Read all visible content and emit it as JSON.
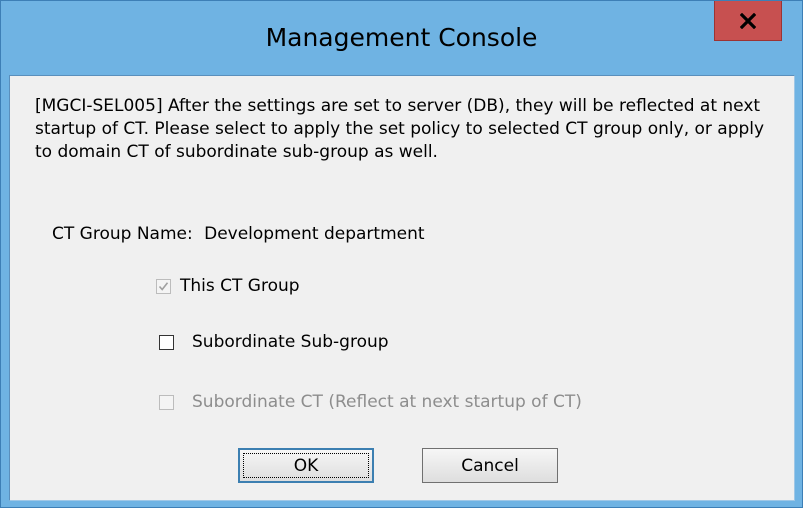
{
  "window": {
    "title": "Management Console",
    "close_icon": "close-icon"
  },
  "dialog": {
    "message": "[MGCI-SEL005] After the settings are set to server (DB), they will be reflected at next startup of CT. Please select to apply the set policy to selected CT group only, or apply to domain CT of subordinate sub-group as well.",
    "group_label": "CT Group Name:",
    "group_value": "Development department",
    "options": [
      {
        "label": "This CT Group",
        "checked": true,
        "enabled": false
      },
      {
        "label": "Subordinate Sub-group",
        "checked": false,
        "enabled": true
      },
      {
        "label": "Subordinate CT (Reflect at next startup of CT)",
        "checked": false,
        "enabled": false
      }
    ],
    "ok_label": "OK",
    "cancel_label": "Cancel"
  },
  "colors": {
    "titlebar": "#6fb3e3",
    "close_button": "#c75050",
    "client_background": "#f0f0f0",
    "disabled_text": "#8d8d8d"
  }
}
